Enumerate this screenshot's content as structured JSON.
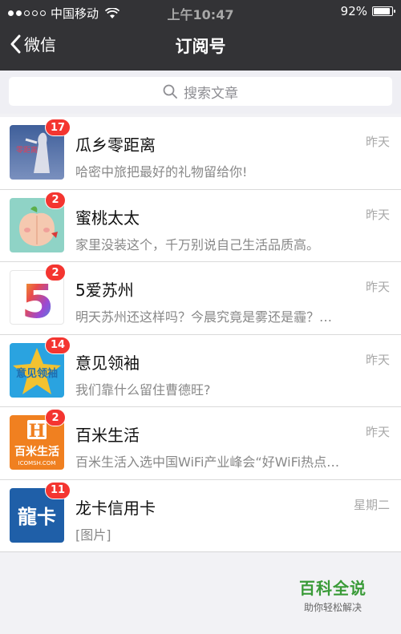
{
  "status_bar": {
    "carrier": "中国移动",
    "time": "上午10:47",
    "battery": "92%",
    "battery_level": 0.92
  },
  "navbar": {
    "back_label": "微信",
    "title": "订阅号"
  },
  "search": {
    "placeholder": "搜索文章"
  },
  "subscriptions": [
    {
      "name": "瓜乡零距离",
      "snippet": "哈密中旅把最好的礼物留给你!",
      "time": "昨天",
      "badge": "17",
      "icon": "guaxiang-avatar",
      "avatar_text": "零距离"
    },
    {
      "name": "蜜桃太太",
      "snippet": "家里没装这个，千万别说自己生活品质高。",
      "time": "昨天",
      "badge": "2",
      "icon": "peach-avatar"
    },
    {
      "name": "5爱苏州",
      "snippet": "明天苏州还这样吗？今晨究竟是雾还是霾？…",
      "time": "昨天",
      "badge": "2",
      "icon": "number-five-avatar",
      "avatar_text": "5"
    },
    {
      "name": "意见领袖",
      "snippet": "我们靠什么留住曹德旺?",
      "time": "昨天",
      "badge": "14",
      "icon": "yijian-avatar",
      "avatar_text": "意见领袖"
    },
    {
      "name": "百米生活",
      "snippet": "百米生活入选中国WiFi产业峰会“好WiFi热点…",
      "time": "昨天",
      "badge": "2",
      "icon": "baimi-avatar",
      "avatar_text": "百米生活",
      "avatar_sub": "ICOMSH.COM"
    },
    {
      "name": "龙卡信用卡",
      "snippet": "[图片]",
      "time": "星期二",
      "badge": "11",
      "icon": "longka-avatar",
      "avatar_text": "龍卡"
    }
  ],
  "watermark": {
    "title": "百科全说",
    "subtitle": "助你轻松解决"
  },
  "colors": {
    "header": "#333336",
    "badge": "#f43530",
    "watermark": "#3a9b38"
  }
}
